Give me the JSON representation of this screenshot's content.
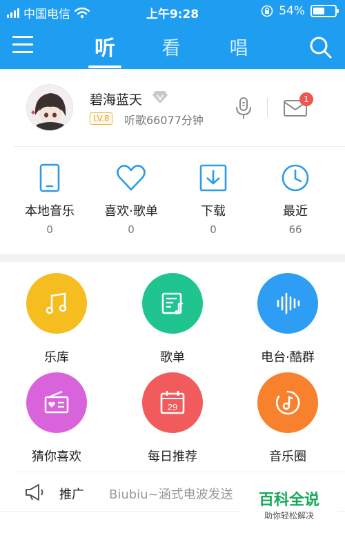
{
  "status_bar": {
    "carrier": "中国电信",
    "time": "上午9:28",
    "battery": "54%",
    "battery_level": 0.54
  },
  "nav": {
    "tabs": [
      {
        "label": "听",
        "active": true
      },
      {
        "label": "看",
        "active": false
      },
      {
        "label": "唱",
        "active": false
      }
    ]
  },
  "profile": {
    "username": "碧海蓝天",
    "level": "LV.8",
    "listen_time": "听歌66077分钟",
    "message_count": "1"
  },
  "quick_links": [
    {
      "label": "本地音乐",
      "count": "0",
      "icon": "phone-icon"
    },
    {
      "label": "喜欢·歌单",
      "count": "0",
      "icon": "heart-icon"
    },
    {
      "label": "下载",
      "count": "0",
      "icon": "download-icon"
    },
    {
      "label": "最近",
      "count": "66",
      "icon": "clock-icon"
    }
  ],
  "grid": [
    {
      "label": "乐库",
      "color": "#f5bd1f",
      "icon": "music-note-icon"
    },
    {
      "label": "歌单",
      "color": "#1fc48f",
      "icon": "playlist-icon"
    },
    {
      "label": "电台·酷群",
      "color": "#2e9ef5",
      "icon": "soundwave-icon"
    },
    {
      "label": "猜你喜欢",
      "color": "#d963db",
      "icon": "radio-icon"
    },
    {
      "label": "每日推荐",
      "color": "#f15b5b",
      "icon": "calendar-icon"
    },
    {
      "label": "音乐圈",
      "color": "#f7812d",
      "icon": "music-circle-icon"
    }
  ],
  "calendar_day": "29",
  "promo": {
    "tag": "推广",
    "text": "Biubiu~涵式电波发送"
  },
  "watermark": {
    "title": "百科全说",
    "subtitle": "助你轻松解决"
  }
}
